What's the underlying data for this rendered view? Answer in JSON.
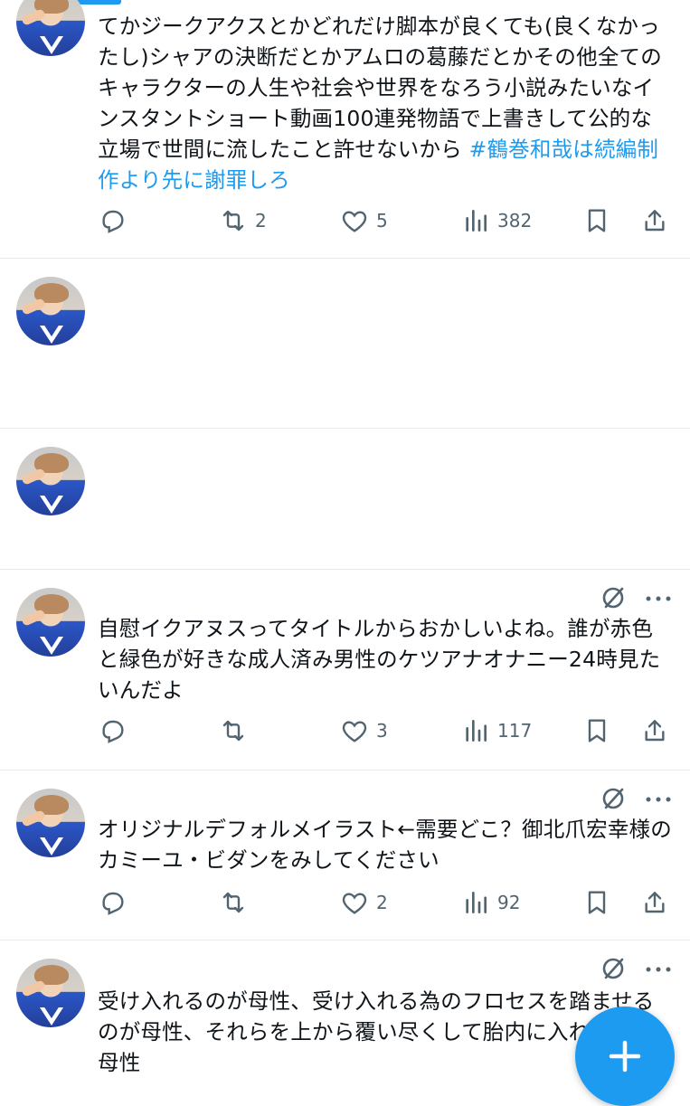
{
  "posts": [
    {
      "id": "post-1",
      "text_main": "てかジークアクスとかどれだけ脚本が良くても(良くなかったし)シャアの決断だとかアムロの葛藤だとかその他全てのキャラクターの人生や社会や世界をなろう小説みたいなインスタントショート動画100連発物語で上書きして公的な立場で世間に流したこと許せないから ",
      "hashtag": "#鶴巻和哉は続編制作より先に謝罪しろ",
      "retweets": "2",
      "likes": "5",
      "views": "382"
    },
    {
      "id": "post-2",
      "text": ""
    },
    {
      "id": "post-3",
      "text": ""
    },
    {
      "id": "post-4",
      "text": "自慰イクアヌスってタイトルからおかしいよね。誰が赤色と緑色が好きな成人済み男性のケツアナオナニー24時見たいんだよ",
      "retweets": "",
      "likes": "3",
      "views": "117"
    },
    {
      "id": "post-5",
      "text": "オリジナルデフォルメイラスト←需要どこ？御北爪宏幸様のカミーユ・ビダンをみしてください",
      "retweets": "",
      "likes": "2",
      "views": "92"
    },
    {
      "id": "post-6",
      "text": "受け入れるのが母性、受け入れる為のフロセスを踏ませるのが母性、それらを上から覆い尽くして胎内に入れ\n母性"
    }
  ],
  "icons": {
    "reply": "reply-icon",
    "retweet": "retweet-icon",
    "like": "heart-icon",
    "views": "views-icon",
    "bookmark": "bookmark-icon",
    "share": "share-icon",
    "grok": "grok-icon",
    "more": "more-icon",
    "compose": "plus-icon"
  },
  "colors": {
    "accent": "#1d9bf0",
    "text": "#0f1419",
    "muted": "#536471",
    "divider": "#e6ecf0"
  }
}
